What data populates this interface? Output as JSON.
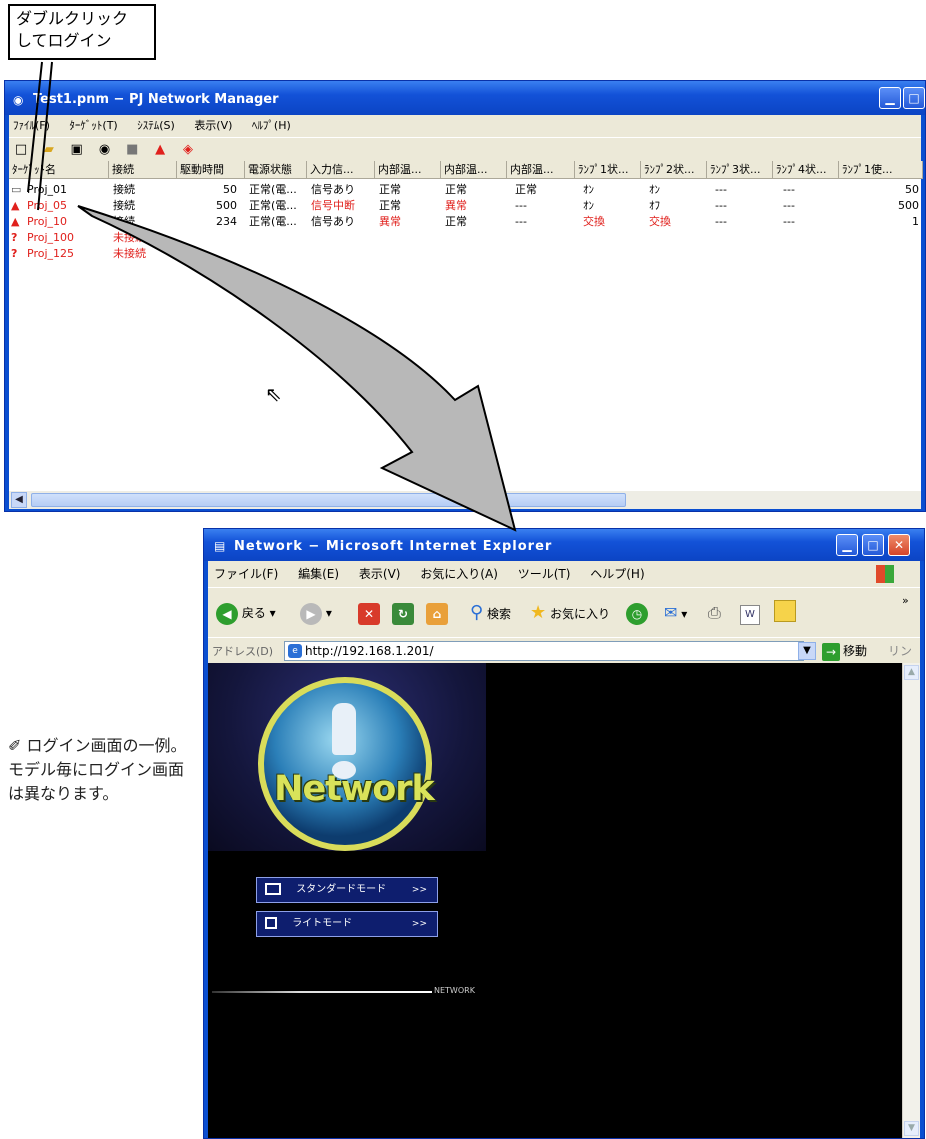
{
  "callout": {
    "line1": "ダブルクリック",
    "line2": "してログイン"
  },
  "manager": {
    "title": "Test1.pnm − PJ Network Manager",
    "menu": [
      "ﾌｧｲﾙ(F)",
      "ﾀｰｹﾞｯﾄ(T)",
      "ｼｽﾃﾑ(S)",
      "表示(V)",
      "ﾍﾙﾌﾟ(H)"
    ],
    "columns": [
      "ﾀｰｹﾞｯﾄ名",
      "接続",
      "駆動時間",
      "電源状態",
      "入力信...",
      "内部温...",
      "内部温...",
      "内部温...",
      "ﾗﾝﾌﾟ1状...",
      "ﾗﾝﾌﾟ2状...",
      "ﾗﾝﾌﾟ3状...",
      "ﾗﾝﾌﾟ4状...",
      "ﾗﾝﾌﾟ1使..."
    ],
    "rows": [
      [
        "Proj_01",
        "接続",
        "50",
        "正常(電...",
        "信号あり",
        "正常",
        "正常",
        "正常",
        "ｵﾝ",
        "ｵﾝ",
        "---",
        "---",
        "50"
      ],
      [
        "Proj_05",
        "接続",
        "500",
        "正常(電...",
        "信号中断",
        "正常",
        "異常",
        "---",
        "ｵﾝ",
        "ｵﾌ",
        "---",
        "---",
        "500"
      ],
      [
        "Proj_10",
        "接続",
        "234",
        "正常(電...",
        "信号あり",
        "異常",
        "正常",
        "---",
        "交換",
        "交換",
        "---",
        "---",
        "1"
      ],
      [
        "Proj_100",
        "未接続",
        "",
        "",
        "",
        "",
        "",
        "",
        "",
        "",
        "",
        "",
        ""
      ],
      [
        "Proj_125",
        "未接続",
        "",
        "",
        "",
        "",
        "",
        "",
        "",
        "",
        "",
        "",
        ""
      ]
    ],
    "row_icons": [
      "projector-icon",
      "warning-icon",
      "warning-icon",
      "question-icon",
      "question-icon"
    ]
  },
  "ie": {
    "title": "Network − Microsoft Internet Explorer",
    "menu": [
      "ファイル(F)",
      "編集(E)",
      "表示(V)",
      "お気に入り(A)",
      "ツール(T)",
      "ヘルプ(H)"
    ],
    "back_label": "戻る",
    "search_label": "検索",
    "favorites_label": "お気に入り",
    "address_label": "アドレス(D)",
    "address_value": "http://192.168.1.201/",
    "go_label": "移動",
    "links_label": "リンク",
    "logo_text": "Network",
    "standard_mode": "スタンダードモード",
    "lite_mode": "ライトモード",
    "mode_arrow": ">>",
    "rule_label": "NETWORK"
  },
  "note": "ログイン画面の一例。モデル毎にログイン画面は異なります。",
  "colors": {
    "alert": "#e0201c",
    "titlebar": "#0b44c4",
    "chrome": "#ece9d8",
    "arrow": "#b8b8b8"
  }
}
